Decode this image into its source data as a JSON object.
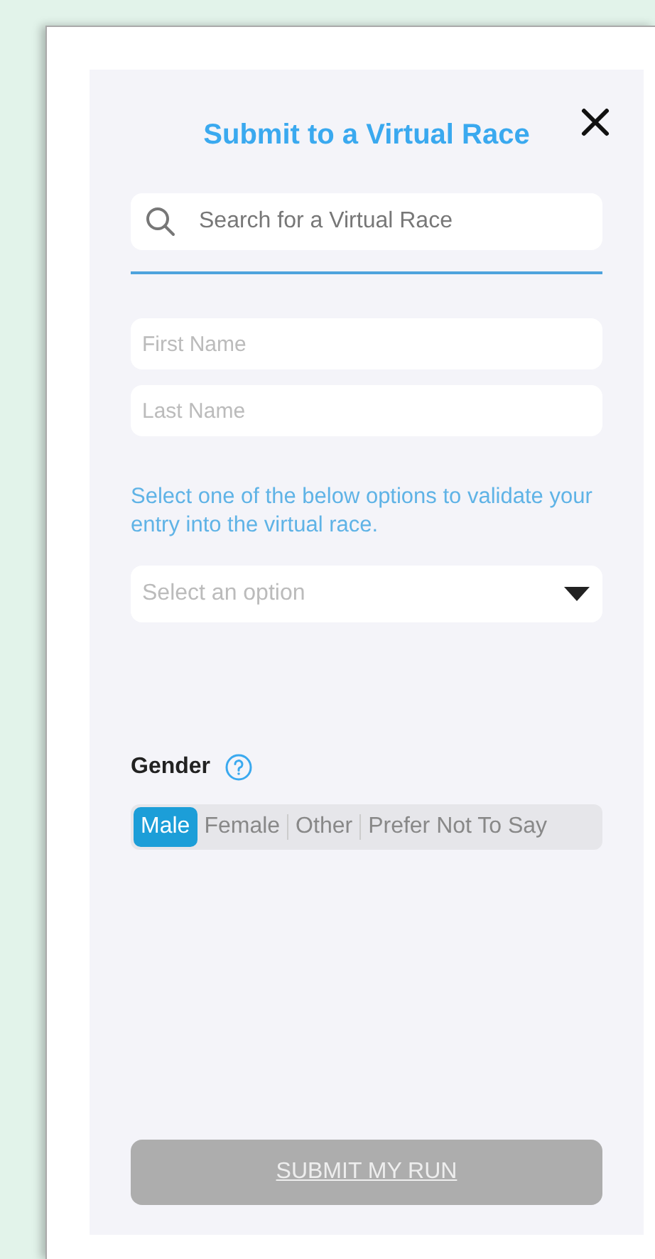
{
  "title": "Submit to a Virtual Race",
  "search": {
    "placeholder": "Search for a Virtual Race"
  },
  "first_name": {
    "placeholder": "First Name"
  },
  "last_name": {
    "placeholder": "Last Name"
  },
  "instruction": "Select one of the below options to validate your entry into the virtual race.",
  "option_select": {
    "placeholder": "Select an option"
  },
  "gender": {
    "label": "Gender",
    "options": [
      {
        "label": "Male",
        "selected": true
      },
      {
        "label": "Female",
        "selected": false
      },
      {
        "label": "Other",
        "selected": false
      },
      {
        "label": "Prefer Not To Say",
        "selected": false
      }
    ]
  },
  "submit_button": {
    "label": "SUBMIT MY RUN",
    "disabled": true
  }
}
